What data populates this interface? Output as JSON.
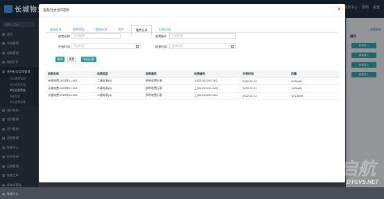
{
  "app": {
    "logo_text": "长城物业",
    "header_right": [
      "消息中心",
      "帮助",
      "设置"
    ]
  },
  "sidebar": {
    "search_placeholder": "请输入菜单",
    "items": [
      {
        "label": "首页",
        "type": "item"
      },
      {
        "label": "系统管理",
        "type": "item"
      },
      {
        "label": "设备管理",
        "type": "item"
      },
      {
        "label": "能耗分析",
        "type": "item"
      },
      {
        "label": "多种社会类保管理",
        "type": "item",
        "active": true
      },
      {
        "label": "社区缴费管理",
        "type": "sub"
      },
      {
        "label": "单位收费管理",
        "type": "sub"
      },
      {
        "label": "单位台账管理",
        "type": "sub",
        "current": true
      },
      {
        "label": "表单管理",
        "type": "sub"
      },
      {
        "label": "单位收费结算",
        "type": "sub"
      },
      {
        "label": "客户服务",
        "type": "item"
      },
      {
        "label": "合同管理",
        "type": "item"
      },
      {
        "label": "资产管理",
        "type": "item"
      },
      {
        "label": "巡检管理",
        "type": "item"
      },
      {
        "label": "报表中心",
        "type": "item"
      },
      {
        "label": "综合查询",
        "type": "item"
      },
      {
        "label": "运维管理",
        "type": "item"
      },
      {
        "label": "报修工单",
        "type": "item"
      },
      {
        "label": "停车场管理",
        "type": "item"
      },
      {
        "label": "数据中心",
        "type": "item"
      }
    ]
  },
  "right_panel": {
    "link": "查看更多",
    "title": "操作",
    "buttons": [
      "新增录入",
      "新增录入",
      "新增录入",
      "新增录入"
    ]
  },
  "modal": {
    "title": "查看/社会合同定制",
    "close": "×",
    "tabs": [
      "基础信息",
      "收费明细",
      "预估计划",
      "附件",
      "缴费记录",
      "抄表记录"
    ],
    "active_tab": 4,
    "form": {
      "name_label": "收费名称",
      "name_placeholder": "全部收费",
      "code_label": "收费编号",
      "code_placeholder": "全部收费",
      "start_label": "开始时间",
      "start_placeholder": "开始时间",
      "end_label": "结束时间",
      "end_placeholder": "结束时间"
    },
    "buttons": {
      "search": "查询",
      "reset": "重置",
      "export": "导出记录"
    },
    "table": {
      "headers": [
        "收费名称",
        "收费类型",
        "收费属性",
        "收费编号",
        "抄表时间",
        "用量"
      ],
      "rows": [
        [
          "计量电费-2022年11-001",
          "二级电表(B)",
          "多种收费分表",
          "上(2D-2022/11-001",
          "2022-01-11",
          "5.00kWh"
        ],
        [
          "计量电费-2022年11-002",
          "二级电表(B)",
          "多种收费分表",
          "上(2D-2022/11-003",
          "2022-01-11",
          "1.50kWh"
        ],
        [
          "计量电费-2022年11-003",
          "二级电表(B)",
          "多种收费分表",
          "上(2D-2022/11-004",
          "2022-01-11",
          "12.1(kWh"
        ]
      ]
    }
  },
  "watermark": {
    "text": "DTGVS.NET",
    "glyphs": "启航"
  }
}
